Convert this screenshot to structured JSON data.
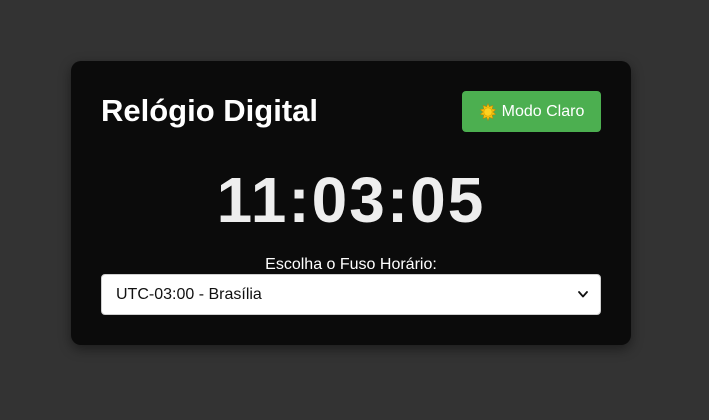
{
  "app": {
    "title": "Relógio Digital"
  },
  "mode_button": {
    "label": "Modo Claro",
    "icon": "sun-icon"
  },
  "clock": {
    "time": "11:03:05"
  },
  "timezone": {
    "label": "Escolha o Fuso Horário:",
    "selected": "UTC-03:00 - Brasília"
  },
  "colors": {
    "page_background": "#333333",
    "card_background": "#0b0b0b",
    "accent": "#4caf50",
    "text": "#ffffff"
  }
}
